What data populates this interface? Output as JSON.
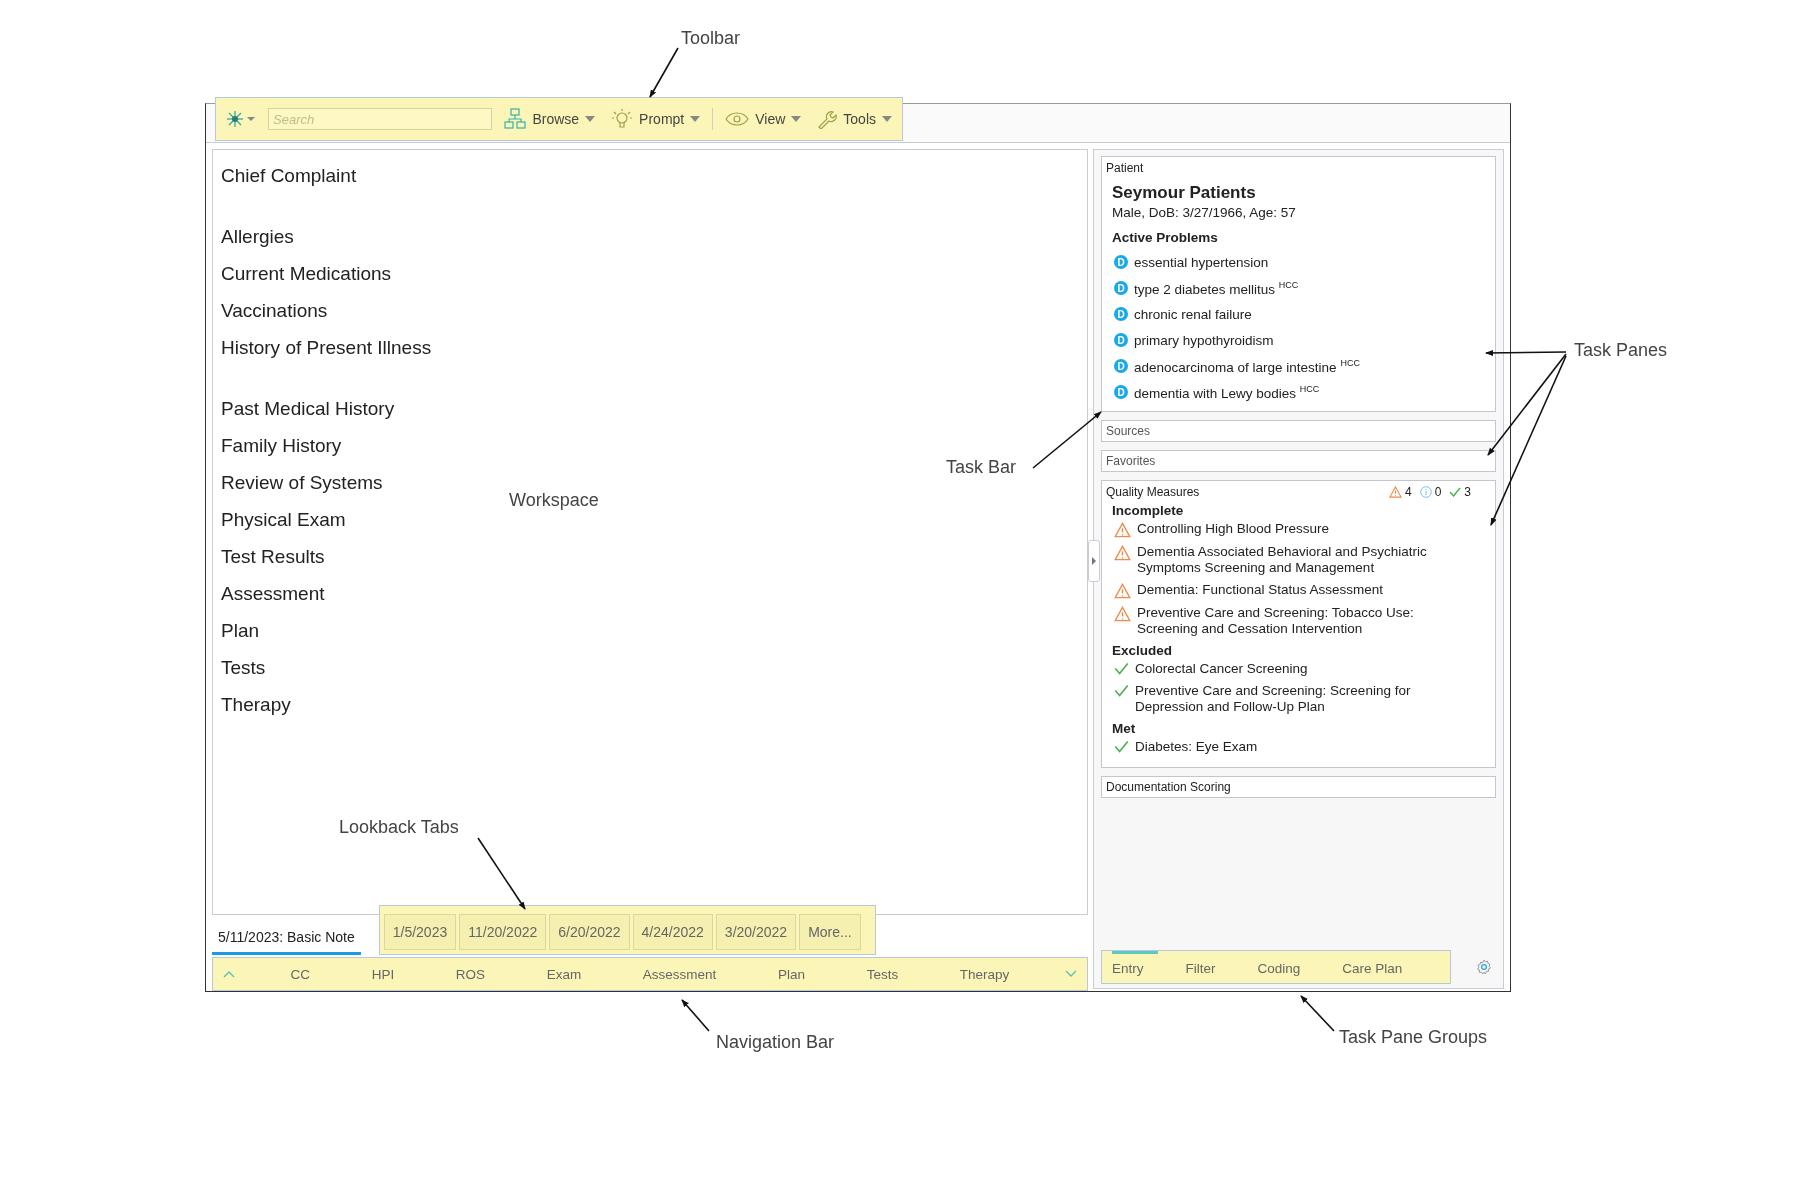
{
  "toolbar": {
    "search": {
      "placeholder": "Search"
    },
    "menus": [
      {
        "label": "Browse"
      },
      {
        "label": "Prompt"
      },
      {
        "label": "View"
      },
      {
        "label": "Tools"
      }
    ]
  },
  "workspace": {
    "section_groups": [
      [
        "Chief Complaint"
      ],
      [
        "Allergies",
        "Current Medications",
        "Vaccinations",
        "History of Present Illness"
      ],
      [
        "Past Medical History",
        "Family History",
        "Review of Systems",
        "Physical Exam",
        "Test Results",
        "Assessment",
        "Plan",
        "Tests",
        "Therapy"
      ]
    ]
  },
  "note_tabs": [
    {
      "label": "5/11/2023: Basic Note",
      "selected": true,
      "kind": "note"
    },
    {
      "label": "1/5/2023",
      "selected": false,
      "kind": "lookback"
    },
    {
      "label": "11/20/2022",
      "selected": false,
      "kind": "lookback"
    },
    {
      "label": "6/20/2022",
      "selected": false,
      "kind": "lookback"
    },
    {
      "label": "4/24/2022",
      "selected": false,
      "kind": "lookback"
    },
    {
      "label": "3/20/2022",
      "selected": false,
      "kind": "lookback"
    },
    {
      "label": "More...",
      "selected": false,
      "kind": "lookback"
    }
  ],
  "navigation_bar": [
    "CC",
    "HPI",
    "ROS",
    "Exam",
    "Assessment",
    "Plan",
    "Tests",
    "Therapy"
  ],
  "patient_pane": {
    "title": "Patient",
    "name": "Seymour Patients",
    "details": "Male, DoB: 3/27/1966, Age: 57",
    "problems_heading": "Active Problems",
    "problems": [
      {
        "badge": "D",
        "text": "essential hypertension"
      },
      {
        "badge": "D",
        "text": "type 2 diabetes mellitus $^{HCC}$"
      },
      {
        "badge": "D",
        "text": "chronic renal failure"
      },
      {
        "badge": "D",
        "text": "primary hypothyroidism"
      },
      {
        "badge": "D",
        "text": "adenocarcinoma of large intestine $^{HCC}$"
      },
      {
        "badge": "D",
        "text": "dementia with Lewy bodies $^{HCC}$"
      }
    ]
  },
  "collapsed_panes": [
    "Sources",
    "Favorites"
  ],
  "quality_measures": {
    "title": "Quality Measures",
    "counts": [
      {
        "kind": "warning",
        "value": "4"
      },
      {
        "kind": "info",
        "value": "0"
      },
      {
        "kind": "check",
        "value": "3"
      }
    ],
    "groups": [
      {
        "heading": "Incomplete",
        "items": [
          {
            "kind": "warning",
            "text": "Controlling High Blood Pressure"
          },
          {
            "kind": "warning",
            "text": "Dementia Associated Behavioral and Psychiatric Symptoms Screening and Management"
          },
          {
            "kind": "warning",
            "text": "Dementia: Functional Status Assessment"
          },
          {
            "kind": "warning",
            "text": "Preventive Care and Screening: Tobacco Use: Screening and Cessation Intervention"
          }
        ]
      },
      {
        "heading": "Excluded",
        "items": [
          {
            "kind": "check",
            "text": "Colorectal Cancer Screening"
          },
          {
            "kind": "check",
            "text": "Preventive Care and Screening: Screening for Depression and Follow-Up Plan"
          }
        ]
      },
      {
        "heading": "Met",
        "items": [
          {
            "kind": "check",
            "text": "Diabetes: Eye Exam"
          }
        ]
      }
    ]
  },
  "bottom_panes": [
    "Documentation Scoring"
  ],
  "pane_groups": [
    {
      "label": "Entry",
      "selected": true
    },
    {
      "label": "Filter",
      "selected": false
    },
    {
      "label": "Coding",
      "selected": false
    },
    {
      "label": "Care Plan",
      "selected": false
    }
  ],
  "annotations": [
    {
      "label": "Toolbar"
    },
    {
      "label": "Task Panes"
    },
    {
      "label": "Task Bar"
    },
    {
      "label": "Workspace"
    },
    {
      "label": "Lookback Tabs"
    },
    {
      "label": "Navigation Bar"
    },
    {
      "label": "Task Pane Groups"
    }
  ]
}
